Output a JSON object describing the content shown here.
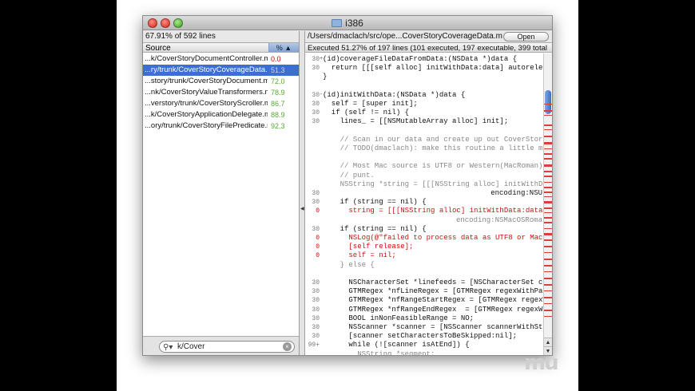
{
  "window": {
    "title": "i386"
  },
  "left": {
    "summary": "67.91% of 592 lines",
    "header_source": "Source",
    "header_pct": "%",
    "files": [
      {
        "name": "...k/CoverStoryDocumentController.m",
        "pct": "0.0",
        "color": "#d40000"
      },
      {
        "name": "...ry/trunk/CoverStoryCoverageData.m",
        "pct": "51.3",
        "color": "#d8d8d8",
        "selected": true
      },
      {
        "name": "...story/trunk/CoverStoryDocument.m",
        "pct": "72.0",
        "color": "#55aa33"
      },
      {
        "name": "...nk/CoverStoryValueTransformers.m",
        "pct": "78.9",
        "color": "#55aa33"
      },
      {
        "name": "...verstory/trunk/CoverStoryScroller.m",
        "pct": "86.7",
        "color": "#55aa33"
      },
      {
        "name": "...k/CoverStoryApplicationDelegate.m",
        "pct": "88.9",
        "color": "#55aa33"
      },
      {
        "name": "...ory/trunk/CoverStoryFilePredicate.m",
        "pct": "92.3",
        "color": "#55aa33"
      }
    ],
    "search_value": "k/Cover"
  },
  "right": {
    "path": "/Users/dmaclach/src/ope...CoverStoryCoverageData.m",
    "open_label": "Open",
    "exec_summary": "Executed 51.27% of 197 lines (101 executed, 197 executable, 399 total",
    "lines": [
      {
        "cnt": "30",
        "disc": "+",
        "txt": "(id)coverageFileDataFromData:(NSData *)data {",
        "style": ""
      },
      {
        "cnt": "30",
        "txt": "  return [[[self alloc] initWithData:data] autorelease];",
        "style": ""
      },
      {
        "cnt": "",
        "txt": "}",
        "style": ""
      },
      {
        "cnt": "",
        "txt": "",
        "style": ""
      },
      {
        "cnt": "30",
        "disc": "-",
        "txt": "(id)initWithData:(NSData *)data {",
        "style": ""
      },
      {
        "cnt": "30",
        "txt": "  self = [super init];",
        "style": ""
      },
      {
        "cnt": "30",
        "txt": "  if (self != nil) {",
        "style": ""
      },
      {
        "cnt": "30",
        "txt": "    lines_ = [[NSMutableArray alloc] init];",
        "style": ""
      },
      {
        "cnt": "",
        "txt": "",
        "style": ""
      },
      {
        "cnt": "",
        "txt": "    // Scan in our data and create up out CoverStoryCovera",
        "style": "gray"
      },
      {
        "cnt": "",
        "txt": "    // TODO(dmaclach): make this routine a little more \"er",
        "style": "gray"
      },
      {
        "cnt": "",
        "txt": "",
        "style": ""
      },
      {
        "cnt": "",
        "txt": "    // Most Mac source is UTF8 or Western(MacRoman), so we",
        "style": "gray"
      },
      {
        "cnt": "",
        "txt": "    // punt.",
        "style": "gray"
      },
      {
        "cnt": "",
        "txt": "    NSString *string = [[[NSString alloc] initWithData:dat",
        "style": "gray"
      },
      {
        "cnt": "30",
        "txt": "",
        "right": "encoding:NSU",
        "rstyle": ""
      },
      {
        "cnt": "30",
        "txt": "    if (string == nil) {",
        "style": ""
      },
      {
        "cnt": "0",
        "txt": "      string = [[[NSString alloc] initWithData:data",
        "style": "red"
      },
      {
        "cnt": "",
        "txt": "",
        "right": "encoding:NSMacOSRoma",
        "rstyle": "gray"
      },
      {
        "cnt": "30",
        "txt": "    if (string == nil) {",
        "style": ""
      },
      {
        "cnt": "0",
        "txt": "      NSLog(@\"failed to process data as UTF8 or MacOSRoman",
        "style": "red"
      },
      {
        "cnt": "0",
        "txt": "      [self release];",
        "style": "red"
      },
      {
        "cnt": "0",
        "txt": "      self = nil;",
        "style": "red"
      },
      {
        "cnt": "",
        "txt": "    } else {",
        "style": "gray"
      },
      {
        "cnt": "",
        "txt": "",
        "style": ""
      },
      {
        "cnt": "30",
        "txt": "      NSCharacterSet *linefeeds = [NSCharacterSet characte",
        "style": ""
      },
      {
        "cnt": "30",
        "txt": "      GTMRegex *nfLineRegex = [GTMRegex regexWithPattern:@",
        "style": ""
      },
      {
        "cnt": "30",
        "txt": "      GTMRegex *nfRangeStartRegex = [GTMRegex regexWithPat",
        "style": ""
      },
      {
        "cnt": "30",
        "txt": "      GTMRegex *nfRangeEndRegex  = [GTMRegex regexWithPatt",
        "style": ""
      },
      {
        "cnt": "30",
        "txt": "      BOOL inNonFeasibleRange = NO;",
        "style": ""
      },
      {
        "cnt": "30",
        "txt": "      NSScanner *scanner = [NSScanner scannerWithString:st",
        "style": ""
      },
      {
        "cnt": "30",
        "txt": "      [scanner setCharactersToBeSkipped:nil];",
        "style": ""
      },
      {
        "cnt": "99+",
        "txt": "      while (![scanner isAtEnd]) {",
        "style": ""
      },
      {
        "cnt": "",
        "txt": "        NSString *segment;",
        "style": "gray"
      }
    ]
  },
  "watermark": "mu"
}
